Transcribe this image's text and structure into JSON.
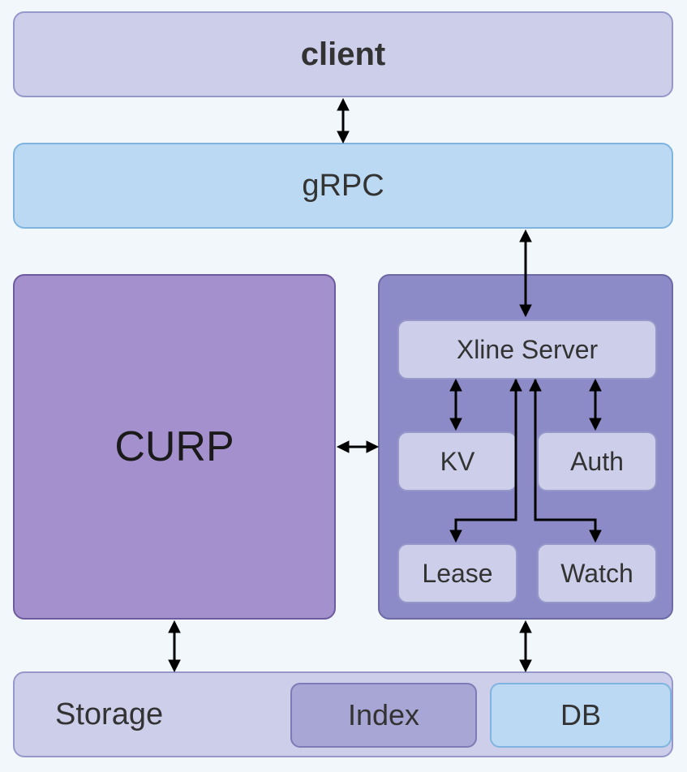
{
  "blocks": {
    "client": "client",
    "grpc": "gRPC",
    "curp": "CURP",
    "server_panel": {
      "xline": "Xline Server",
      "kv": "KV",
      "auth": "Auth",
      "lease": "Lease",
      "watch": "Watch"
    },
    "storage": {
      "label": "Storage",
      "index": "Index",
      "db": "DB"
    }
  },
  "colors": {
    "bg": "#f2f7fc",
    "lavender_fill": "#cdceea",
    "lavender_border": "#9598c9",
    "blue_fill": "#bbd9f2",
    "blue_border": "#7fb4e0",
    "purple_fill": "#a590ce",
    "purple_border": "#6e5a9e",
    "slate_fill": "#8d8bc7",
    "slate_border": "#6b6aa5",
    "index_fill": "#a8a6d4",
    "index_border": "#7d7bb5"
  },
  "connections": [
    {
      "from": "client",
      "to": "grpc",
      "bidirectional": true
    },
    {
      "from": "grpc",
      "to": "server_panel",
      "bidirectional": true
    },
    {
      "from": "curp",
      "to": "server_panel",
      "bidirectional": true
    },
    {
      "from": "xline",
      "to": "kv",
      "bidirectional": true
    },
    {
      "from": "xline",
      "to": "auth",
      "bidirectional": true
    },
    {
      "from": "xline",
      "to": "lease",
      "bidirectional": false
    },
    {
      "from": "xline",
      "to": "watch",
      "bidirectional": false
    },
    {
      "from": "curp",
      "to": "storage",
      "bidirectional": true
    },
    {
      "from": "server_panel",
      "to": "storage",
      "bidirectional": true
    }
  ]
}
